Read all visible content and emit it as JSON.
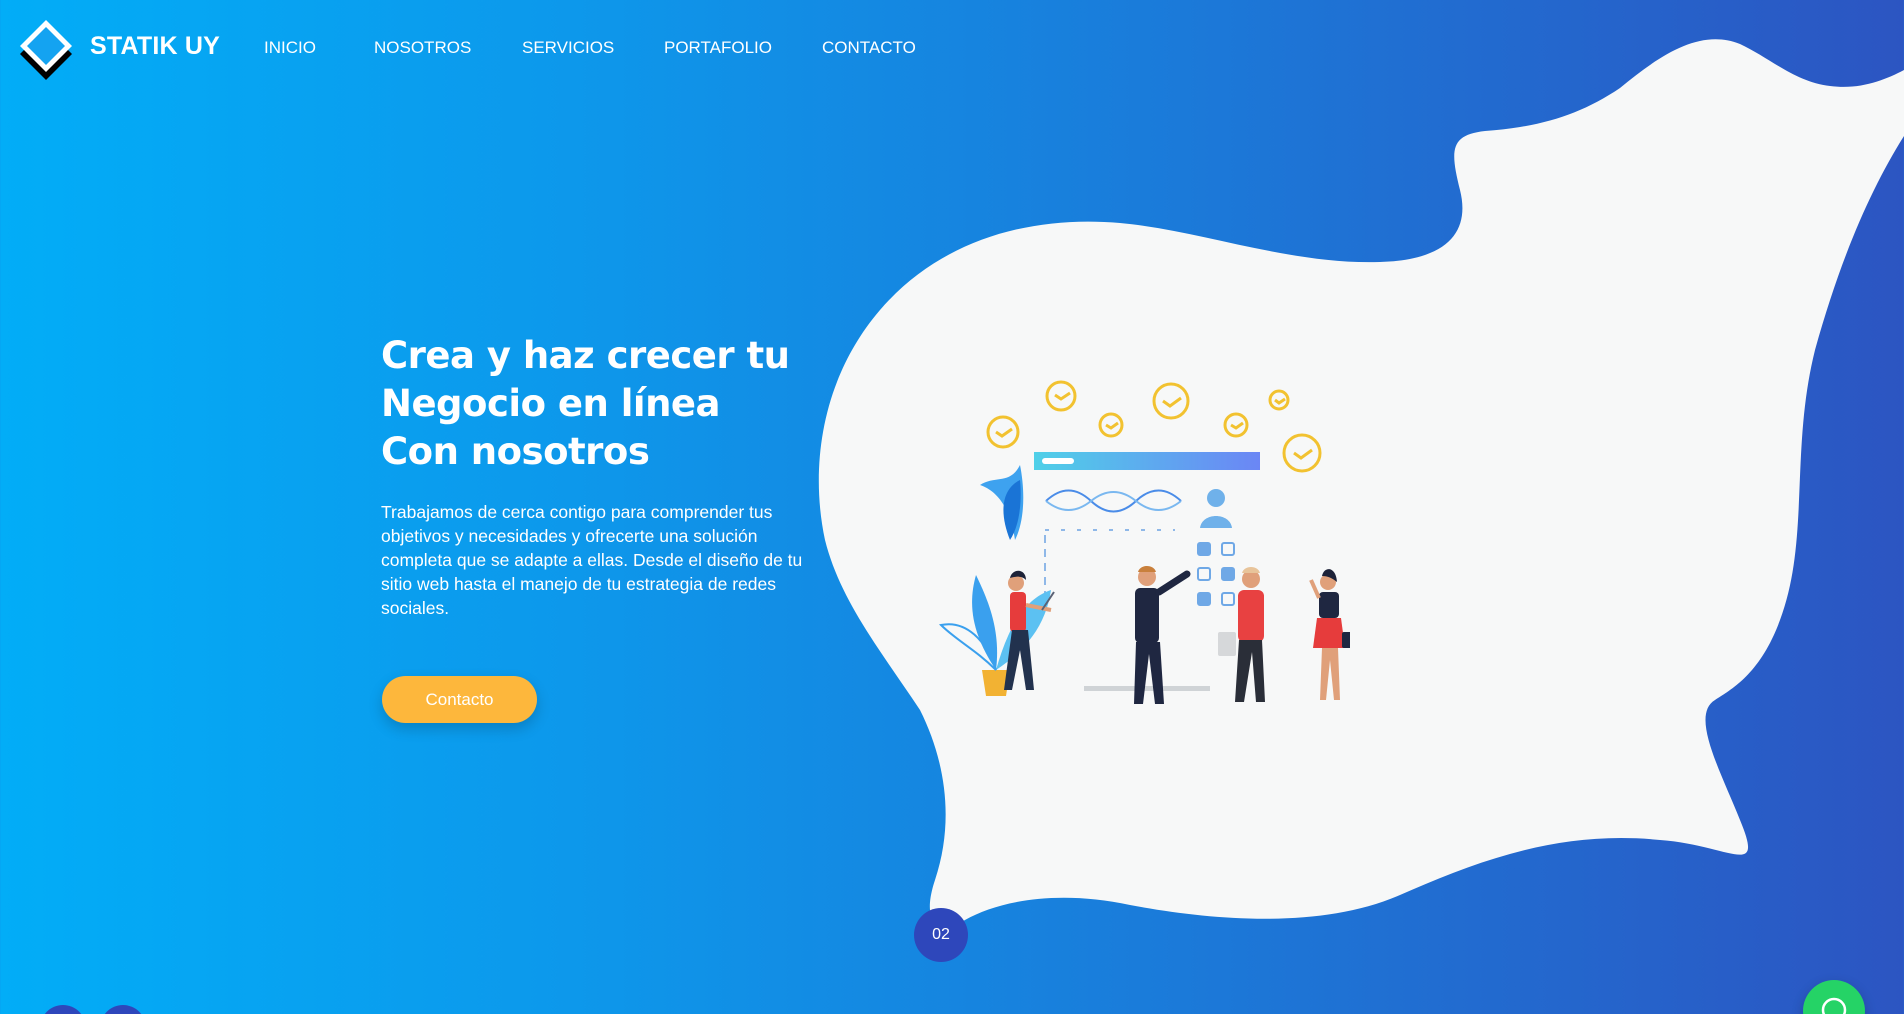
{
  "brand": {
    "name": "STATIK UY"
  },
  "nav": {
    "items": [
      {
        "label": "INICIO"
      },
      {
        "label": "NOSOTROS"
      },
      {
        "label": "SERVICIOS"
      },
      {
        "label": "PORTAFOLIO"
      },
      {
        "label": "CONTACTO"
      }
    ]
  },
  "hero": {
    "title_lines": [
      "Crea y haz crecer tu",
      "Negocio en línea",
      "Con nosotros"
    ],
    "description": "Trabajamos de cerca contigo para comprender tus objetivos y necesidades y ofrecerte una solución completa que se adapte a ellas. Desde el diseño de tu sitio web hasta el manejo de tu estrategia de redes sociales.",
    "cta_label": "Contacto"
  },
  "slider": {
    "current": "02"
  },
  "colors": {
    "gradient_start": "#02adf7",
    "gradient_end": "#2c55c2",
    "blob": "#f7f8f8",
    "cta": "#fdb73c",
    "indicator": "#2e47bb",
    "whatsapp": "#25d366"
  },
  "icons": {
    "logo": "diamond-logo-icon",
    "whatsapp": "whatsapp-icon"
  }
}
